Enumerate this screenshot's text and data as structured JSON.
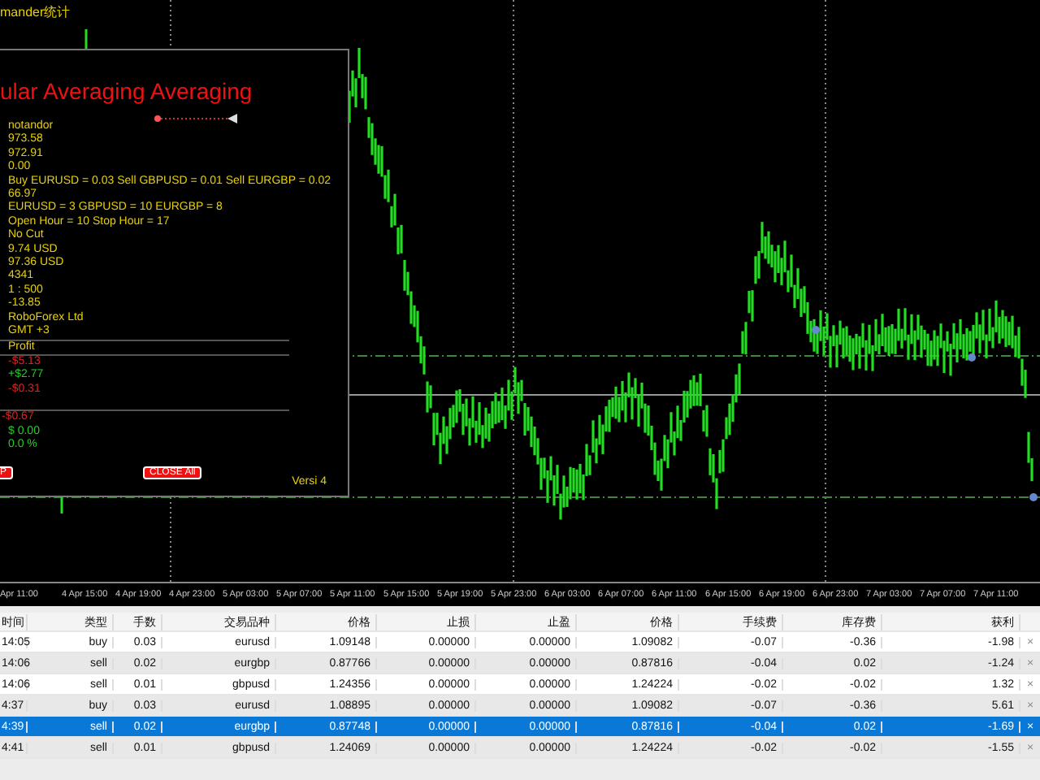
{
  "window": {
    "title": "mander统计"
  },
  "panel": {
    "title": "ular Averaging Averaging",
    "info_lines": [
      "notandor",
      "973.58",
      "972.91",
      "0.00",
      "Buy EURUSD = 0.03    Sell GBPUSD = 0.01    Sell EURGBP = 0.02",
      "66.97",
      "EURUSD = 3   GBPUSD = 10   EURGBP = 8",
      "Open Hour = 10     Stop Hour = 17",
      "No Cut",
      "9.74 USD",
      "97.36 USD",
      "4341",
      "1 : 500",
      "-13.85",
      "RoboForex Ltd",
      "GMT +3"
    ],
    "profit_header": "Profit",
    "profit_lines": [
      {
        "text": "-$5.13",
        "color": "#e02020"
      },
      {
        "text": "+$2.77",
        "color": "#20d020"
      },
      {
        "text": "-$0.31",
        "color": "#e02020"
      }
    ],
    "totals": [
      {
        "text": "-$0.67",
        "color": "#e02020"
      },
      {
        "text": "$  0.00",
        "color": "#20d020"
      },
      {
        "text": "0.0 %",
        "color": "#20d020"
      }
    ],
    "buttons": [
      "P",
      "CLOSE All"
    ],
    "version": "Versi 4"
  },
  "time_axis": [
    "Apr 11:00",
    "4 Apr 15:00",
    "4 Apr 19:00",
    "4 Apr 23:00",
    "5 Apr 03:00",
    "5 Apr 07:00",
    "5 Apr 11:00",
    "5 Apr 15:00",
    "5 Apr 19:00",
    "5 Apr 23:00",
    "6 Apr 03:00",
    "6 Apr 07:00",
    "6 Apr 11:00",
    "6 Apr 15:00",
    "6 Apr 19:00",
    "6 Apr 23:00",
    "7 Apr 03:00",
    "7 Apr 07:00",
    "7 Apr 11:00"
  ],
  "table": {
    "columns": [
      "时间",
      "类型",
      "手数",
      "交易品种",
      "价格",
      "止损",
      "止盈",
      "价格",
      "手续费",
      "库存费",
      "获利"
    ],
    "rows": [
      {
        "cells": [
          "14:05",
          "buy",
          "0.03",
          "eurusd",
          "1.09148",
          "0.00000",
          "0.00000",
          "1.09082",
          "-0.07",
          "-0.36",
          "-1.98"
        ],
        "close": "×",
        "selected": false
      },
      {
        "cells": [
          "14:06",
          "sell",
          "0.02",
          "eurgbp",
          "0.87766",
          "0.00000",
          "0.00000",
          "0.87816",
          "-0.04",
          "0.02",
          "-1.24"
        ],
        "close": "×",
        "selected": false
      },
      {
        "cells": [
          "14:06",
          "sell",
          "0.01",
          "gbpusd",
          "1.24356",
          "0.00000",
          "0.00000",
          "1.24224",
          "-0.02",
          "-0.02",
          "1.32"
        ],
        "close": "×",
        "selected": false
      },
      {
        "cells": [
          "4:37",
          "buy",
          "0.03",
          "eurusd",
          "1.08895",
          "0.00000",
          "0.00000",
          "1.09082",
          "-0.07",
          "-0.36",
          "5.61"
        ],
        "close": "×",
        "selected": false
      },
      {
        "cells": [
          "4:39",
          "sell",
          "0.02",
          "eurgbp",
          "0.87748",
          "0.00000",
          "0.00000",
          "0.87816",
          "-0.04",
          "0.02",
          "-1.69"
        ],
        "close": "×",
        "selected": true
      },
      {
        "cells": [
          "4:41",
          "sell",
          "0.01",
          "gbpusd",
          "1.24069",
          "0.00000",
          "0.00000",
          "1.24224",
          "-0.02",
          "-0.02",
          "-1.55"
        ],
        "close": "×",
        "selected": false
      }
    ]
  }
}
